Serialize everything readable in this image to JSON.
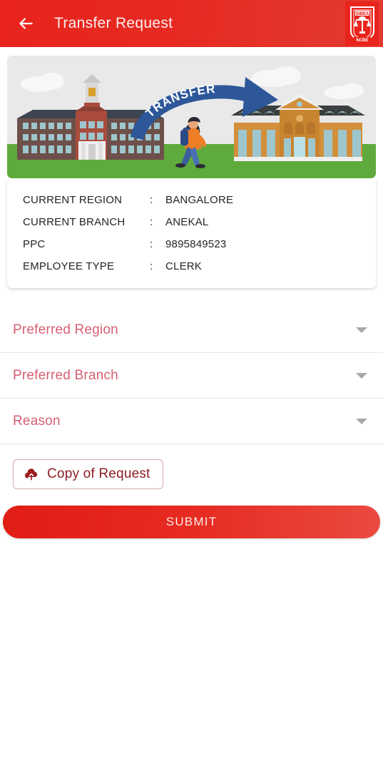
{
  "appbar": {
    "back_icon": "arrow-left-icon",
    "title": "Transfer Request",
    "logo_top_text": "SIBEA",
    "logo_bottom_text": "NCBE",
    "bg_color": "#e8241c",
    "title_color": "#fdeeee"
  },
  "banner": {
    "alt": "transfer-illustration",
    "arrow_text": "TRANSFER",
    "sky_color": "#e9e9e9",
    "ground_color": "#5faa3c",
    "arrow_color": "#2e5799",
    "left_building_color": "#a94c3d",
    "right_building_color": "#d28f3c"
  },
  "info_card": {
    "rows": [
      {
        "label": "CURRENT REGION",
        "colon": ":",
        "value": "BANGALORE"
      },
      {
        "label": "CURRENT BRANCH",
        "colon": ":",
        "value": "ANEKAL"
      },
      {
        "label": "PPC",
        "colon": ":",
        "value": "9895849523"
      },
      {
        "label": "EMPLOYEE TYPE",
        "colon": ":",
        "value": "CLERK"
      }
    ]
  },
  "fields": [
    {
      "label": "Preferred Region",
      "name": "preferred-region",
      "caret": "chevron-down-icon"
    },
    {
      "label": "Preferred Branch",
      "name": "preferred-branch",
      "caret": "chevron-down-icon"
    },
    {
      "label": "Reason",
      "name": "reason",
      "caret": "chevron-down-icon"
    }
  ],
  "upload": {
    "icon": "cloud-upload-icon",
    "label": "Copy of Request",
    "text_color": "#8c1f24",
    "border_color": "#d8a6a6"
  },
  "submit": {
    "label": "SUBMIT",
    "bg_color": "#e62b22",
    "text_color": "#fde9e9"
  },
  "field_label_color": "#d46073"
}
